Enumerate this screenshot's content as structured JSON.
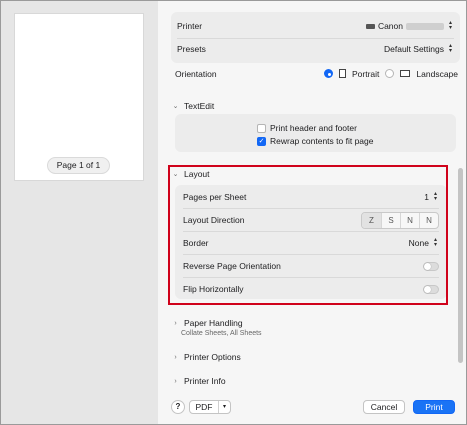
{
  "preview": {
    "page_label": "Page 1 of 1"
  },
  "printer": {
    "label": "Printer",
    "value": "Canon"
  },
  "presets": {
    "label": "Presets",
    "value": "Default Settings"
  },
  "orientation": {
    "label": "Orientation",
    "portrait": "Portrait",
    "landscape": "Landscape",
    "selected": "Portrait"
  },
  "textedit": {
    "title": "TextEdit",
    "print_header_footer": {
      "label": "Print header and footer",
      "checked": false
    },
    "rewrap": {
      "label": "Rewrap contents to fit page",
      "checked": true
    }
  },
  "layout": {
    "title": "Layout",
    "pages_per_sheet": {
      "label": "Pages per Sheet",
      "value": "1"
    },
    "direction": {
      "label": "Layout Direction",
      "options": [
        "Z",
        "S",
        "N",
        "N"
      ],
      "selected": 0
    },
    "border": {
      "label": "Border",
      "value": "None"
    },
    "reverse": {
      "label": "Reverse Page Orientation",
      "on": false
    },
    "flip": {
      "label": "Flip Horizontally",
      "on": false
    }
  },
  "paper_handling": {
    "title": "Paper Handling",
    "caption": "Collate Sheets, All Sheets"
  },
  "printer_options": {
    "title": "Printer Options"
  },
  "printer_info": {
    "title": "Printer Info"
  },
  "buttons": {
    "help": "?",
    "pdf": "PDF",
    "cancel": "Cancel",
    "print": "Print"
  },
  "colors": {
    "accent": "#1267f5",
    "highlight": "#d0021b"
  },
  "icons": {
    "section_chevron": "chevron-down-icon",
    "collapsed_chevron": "chevron-right-icon",
    "stepper": "up-down-stepper-icon",
    "printer": "printer-icon"
  }
}
